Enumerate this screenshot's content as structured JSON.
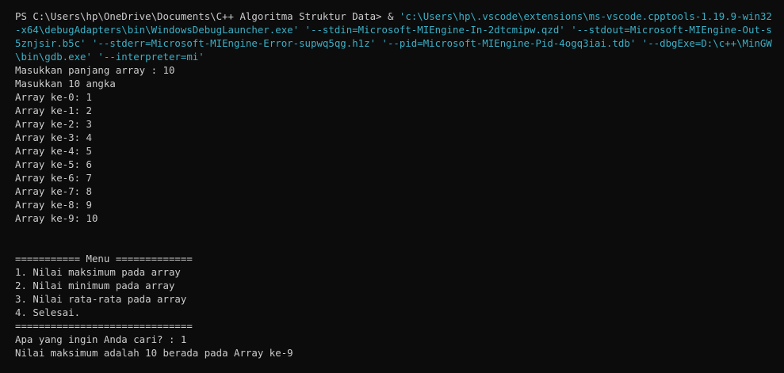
{
  "prompt": {
    "ps_prefix": "PS C:\\Users\\hp\\OneDrive\\Documents\\C++ Algoritma Struktur Data>",
    "operator": " & ",
    "command_args": "'c:\\Users\\hp\\.vscode\\extensions\\ms-vscode.cpptools-1.19.9-win32-x64\\debugAdapters\\bin\\WindowsDebugLauncher.exe' '--stdin=Microsoft-MIEngine-In-2dtcmipw.qzd' '--stdout=Microsoft-MIEngine-Out-s5znjsir.b5c' '--stderr=Microsoft-MIEngine-Error-supwq5qg.h1z' '--pid=Microsoft-MIEngine-Pid-4ogq3iai.tdb' '--dbgExe=D:\\c++\\MinGW\\bin\\gdb.exe' '--interpreter=mi'"
  },
  "output": {
    "input_size": "Masukkan panjang array : 10",
    "input_prompt": "Masukkan 10 angka",
    "array_lines": [
      "Array ke-0: 1",
      "Array ke-1: 2",
      "Array ke-2: 3",
      "Array ke-3: 4",
      "Array ke-4: 5",
      "Array ke-5: 6",
      "Array ke-6: 7",
      "Array ke-7: 8",
      "Array ke-8: 9",
      "Array ke-9: 10"
    ],
    "menu_header": "=========== Menu =============",
    "menu_items": [
      "1. Nilai maksimum pada array",
      "2. Nilai minimum pada array",
      "3. Nilai rata-rata pada array",
      "4. Selesai."
    ],
    "menu_footer": "==============================",
    "question": "Apa yang ingin Anda cari? : 1",
    "result": "Nilai maksimum adalah 10 berada pada Array ke-9"
  },
  "colors": {
    "background": "#0c0c0c",
    "text": "#cccccc",
    "string_args": "#3bb0c7"
  }
}
